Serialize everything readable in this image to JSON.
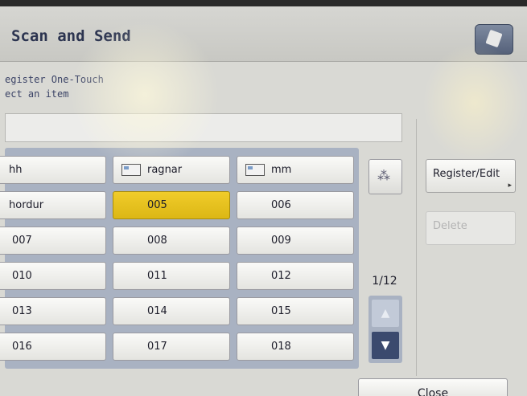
{
  "header": {
    "title": "Scan and Send"
  },
  "instructions": {
    "line1": "egister One-Touch",
    "line2": "ect an item"
  },
  "grid": {
    "rows": [
      [
        {
          "label": "hh",
          "icon": "card-icon"
        },
        {
          "label": "ragnar",
          "icon": "card-icon"
        },
        {
          "label": "mm",
          "icon": "card-icon"
        }
      ],
      [
        {
          "label": "hordur",
          "icon": "card-icon"
        },
        {
          "label": "005",
          "selected": true
        },
        {
          "label": "006"
        }
      ],
      [
        {
          "label": "007"
        },
        {
          "label": "008"
        },
        {
          "label": "009"
        }
      ],
      [
        {
          "label": "010"
        },
        {
          "label": "011"
        },
        {
          "label": "012"
        }
      ],
      [
        {
          "label": "013"
        },
        {
          "label": "014"
        },
        {
          "label": "015"
        }
      ],
      [
        {
          "label": "016"
        },
        {
          "label": "017"
        },
        {
          "label": "018"
        }
      ]
    ]
  },
  "pager": {
    "label": "1/12",
    "up_icon": "arrow-up-icon",
    "down_icon": "arrow-down-icon"
  },
  "side": {
    "register_label": "Register/Edit",
    "delete_label": "Delete"
  },
  "footer": {
    "close_label": "Close"
  },
  "colors": {
    "selected": "#e2bd1a",
    "panel": "#a9b2c2",
    "title": "#2c3450"
  }
}
